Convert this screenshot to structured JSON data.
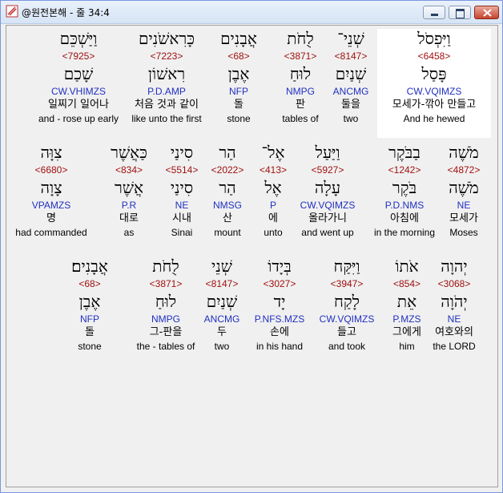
{
  "window": {
    "title": "@원전본해 - 줄 34:4"
  },
  "rows": [
    {
      "words": [
        {
          "heb": "וַיִּפְסֹל",
          "num": "<6458>",
          "lemma": "פָּסַל",
          "morph": "CW.VQIMZS",
          "kor": "모세가-깎아 만들고",
          "eng": "And he hewed",
          "highlight": true
        },
        {
          "heb": "שְׁנֵי־",
          "num": "<8147>",
          "lemma": "שְׁנַיִם",
          "morph": "ANCMG",
          "kor": "둘을",
          "eng": "two"
        },
        {
          "heb": "לֻחֹת",
          "num": "<3871>",
          "lemma": "לוּחַ",
          "morph": "NMPG",
          "kor": "판",
          "eng": "tables of"
        },
        {
          "heb": "אֲבָנִים",
          "num": "<68>",
          "lemma": "אֶבֶן",
          "morph": "NFP",
          "kor": "돌",
          "eng": "stone"
        },
        {
          "heb": "כָּרִאשֹׁנִים",
          "num": "<7223>",
          "lemma": "רִאשׁוֹן",
          "morph": "P.D.AMP",
          "kor": "처음 것과 같이",
          "eng": "like unto the first"
        },
        {
          "heb": "וַיַּשְׁכֵּם",
          "num": "<7925>",
          "lemma": "שָׁכַם",
          "morph": "CW.VHIMZS",
          "kor": "일찌기 일어나",
          "eng": "and - rose up early"
        }
      ]
    },
    {
      "words": [
        {
          "heb": "מֹשֶׁה",
          "num": "<4872>",
          "lemma": "מֹשֶׁה",
          "morph": "NE",
          "kor": "모세가",
          "eng": "Moses"
        },
        {
          "heb": "בַבֹּקֶר",
          "num": "<1242>",
          "lemma": "בֹּקֶר",
          "morph": "P.D.NMS",
          "kor": "아침에",
          "eng": "in the morning"
        },
        {
          "heb": "וַיַּעַל",
          "num": "<5927>",
          "lemma": "עָלָה",
          "morph": "CW.VQIMZS",
          "kor": "올라가니",
          "eng": "and went up"
        },
        {
          "heb": "אֶל־",
          "num": "<413>",
          "lemma": "אֶל",
          "morph": "P",
          "kor": "에",
          "eng": "unto"
        },
        {
          "heb": "הַר",
          "num": "<2022>",
          "lemma": "הַר",
          "morph": "NMSG",
          "kor": "산",
          "eng": "mount"
        },
        {
          "heb": "סִינַי",
          "num": "<5514>",
          "lemma": "סִינַי",
          "morph": "NE",
          "kor": "시내",
          "eng": "Sinai"
        },
        {
          "heb": "כַּאֲשֶׁר",
          "num": "<834>",
          "lemma": "אֲשֶׁר",
          "morph": "P.R",
          "kor": "대로",
          "eng": "as"
        },
        {
          "heb": "צִוָּה",
          "num": "<6680>",
          "lemma": "צָוָה",
          "morph": "VPAMZS",
          "kor": "명",
          "eng": "had commanded"
        }
      ]
    },
    {
      "words": [
        {
          "heb": "יְהוָה",
          "num": "<3068>",
          "lemma": "יְהֹוָה",
          "morph": "NE",
          "kor": "여호와의",
          "eng": "the LORD"
        },
        {
          "heb": "אֹתוֹ",
          "num": "<854>",
          "lemma": "אֵת",
          "morph": "P.MZS",
          "kor": "그에게",
          "eng": "him"
        },
        {
          "heb": "וַיִּקַּח",
          "num": "<3947>",
          "lemma": "לָקַח",
          "morph": "CW.VQIMZS",
          "kor": "들고",
          "eng": "and took"
        },
        {
          "heb": "בְּיָדוֹ",
          "num": "<3027>",
          "lemma": "יָד",
          "morph": "P.NFS.MZS",
          "kor": "손에",
          "eng": "in his hand"
        },
        {
          "heb": "שְׁנֵי",
          "num": "<8147>",
          "lemma": "שְׁנַיִם",
          "morph": "ANCMG",
          "kor": "두",
          "eng": "two"
        },
        {
          "heb": "לֻחֹת",
          "num": "<3871>",
          "lemma": "לוּחַ",
          "morph": "NMPG",
          "kor": "그-판을",
          "eng": "the - tables of"
        },
        {
          "heb": "אֲבָנִים׃",
          "num": "<68>",
          "lemma": "אֶבֶן",
          "morph": "NFP",
          "kor": "돌",
          "eng": "stone"
        }
      ]
    }
  ]
}
